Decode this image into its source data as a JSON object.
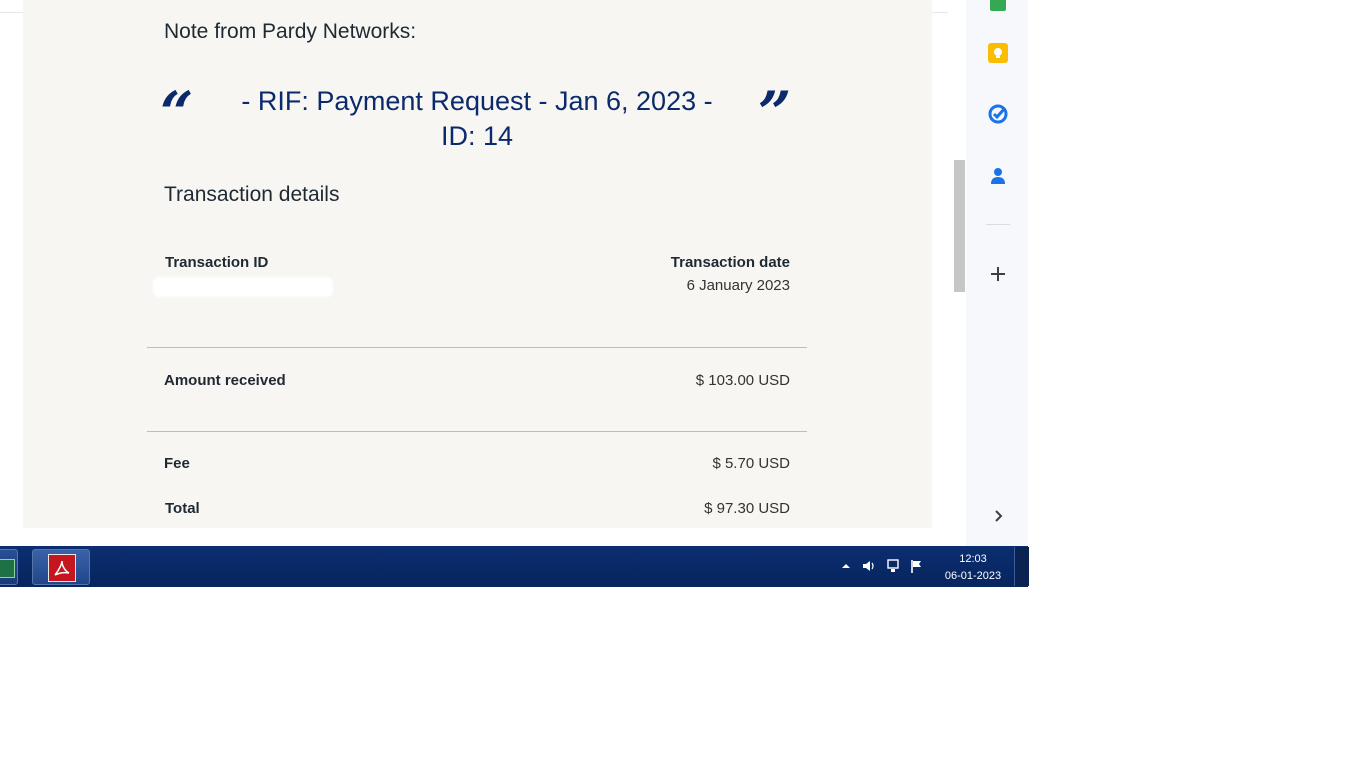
{
  "email": {
    "note_heading": "Note from Pardy Networks:",
    "quote_open": "“",
    "quote_close": "”",
    "note_text": "- RIF: Payment Request - Jan 6, 2023 - ID: 14",
    "section_title": "Transaction details",
    "transaction_id_label": "Transaction ID",
    "transaction_date_label": "Transaction date",
    "transaction_date_value": "6 January 2023",
    "amount_received_label": "Amount received",
    "amount_received_value": "$ 103.00 USD",
    "fee_label": "Fee",
    "fee_value": "$ 5.70 USD",
    "total_label": "Total",
    "total_value": "$ 97.30 USD"
  },
  "side_panel": {
    "icons": [
      "keep-icon",
      "tasks-icon",
      "contacts-icon",
      "add-icon",
      "expand-chevron-icon"
    ],
    "colors": {
      "keep": "#fbbc04",
      "tasks": "#1a73e8",
      "contacts": "#1a73e8"
    }
  },
  "taskbar": {
    "apps": [
      "excel-icon",
      "adobe-reader-icon"
    ],
    "time": "12:03",
    "date": "06-01-2023"
  },
  "colors": {
    "card_background": "#f7f6f3",
    "quote_color": "#0b2a6b",
    "taskbar": "#07255e"
  }
}
